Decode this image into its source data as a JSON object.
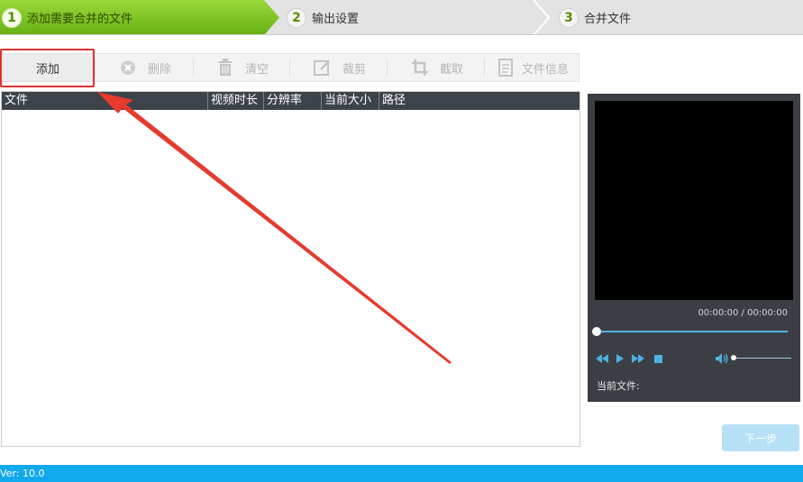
{
  "steps": [
    {
      "number": "1",
      "label": "添加需要合并的文件"
    },
    {
      "number": "2",
      "label": "输出设置"
    },
    {
      "number": "3",
      "label": "合并文件"
    }
  ],
  "toolbar": {
    "add": "添加",
    "delete": "删除",
    "clear": "清空",
    "crop": "裁剪",
    "capture": "截取",
    "file_info": "文件信息"
  },
  "table": {
    "columns": [
      "文件",
      "视频时长",
      "分辨率",
      "当前大小",
      "路径"
    ],
    "rows": []
  },
  "preview": {
    "time": "00:00:00 / 00:00:00",
    "current_file_label": "当前文件:"
  },
  "next_button": "下一步",
  "status": {
    "version": "Ver: 10.0"
  },
  "colors": {
    "step_active": "#7cc21f",
    "status_bar": "#0fa9ec",
    "annotation": "#e03030",
    "accent": "#4fb1e0"
  }
}
